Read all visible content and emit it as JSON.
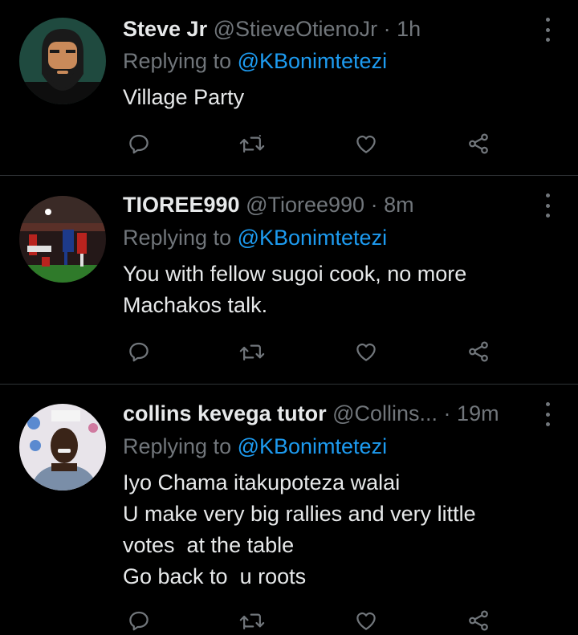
{
  "colors": {
    "background": "#000000",
    "primary_text": "#e7e9ea",
    "secondary_text": "#71767b",
    "link": "#1d9bf0",
    "divider": "#2f3336"
  },
  "replying_prefix": "Replying to ",
  "tweets": [
    {
      "display_name": "Steve Jr",
      "handle": "@StieveOtienoJr",
      "separator": " · ",
      "time": "1h",
      "replying_to": "@KBonimtetezi",
      "text": "Village Party",
      "avatar": "bearded-man-avatar"
    },
    {
      "display_name": "TIOREE990",
      "handle": "@Tioree990",
      "separator": " · ",
      "time": "8m",
      "replying_to": "@KBonimtetezi",
      "text": "You with fellow sugoi cook, no more\nMachakos talk.",
      "avatar": "football-match-avatar"
    },
    {
      "display_name": "collins kevega tutor",
      "handle": "@Collins...",
      "separator": " · ",
      "time": "19m",
      "replying_to": "@KBonimtetezi",
      "text": "Iyo Chama itakupoteza walai\nU make very big rallies and very little\nvotes  at the table\nGo back to  u roots",
      "avatar": "man-photo-avatar"
    }
  ],
  "action_icons": [
    "reply-icon",
    "retweet-icon",
    "like-icon",
    "share-icon"
  ]
}
